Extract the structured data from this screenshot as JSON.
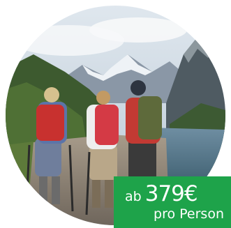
{
  "price": {
    "prefix": "ab",
    "amount": "379€",
    "suffix": "pro Person"
  },
  "colors": {
    "badge": "#1ea34a",
    "text": "#ffffff"
  }
}
